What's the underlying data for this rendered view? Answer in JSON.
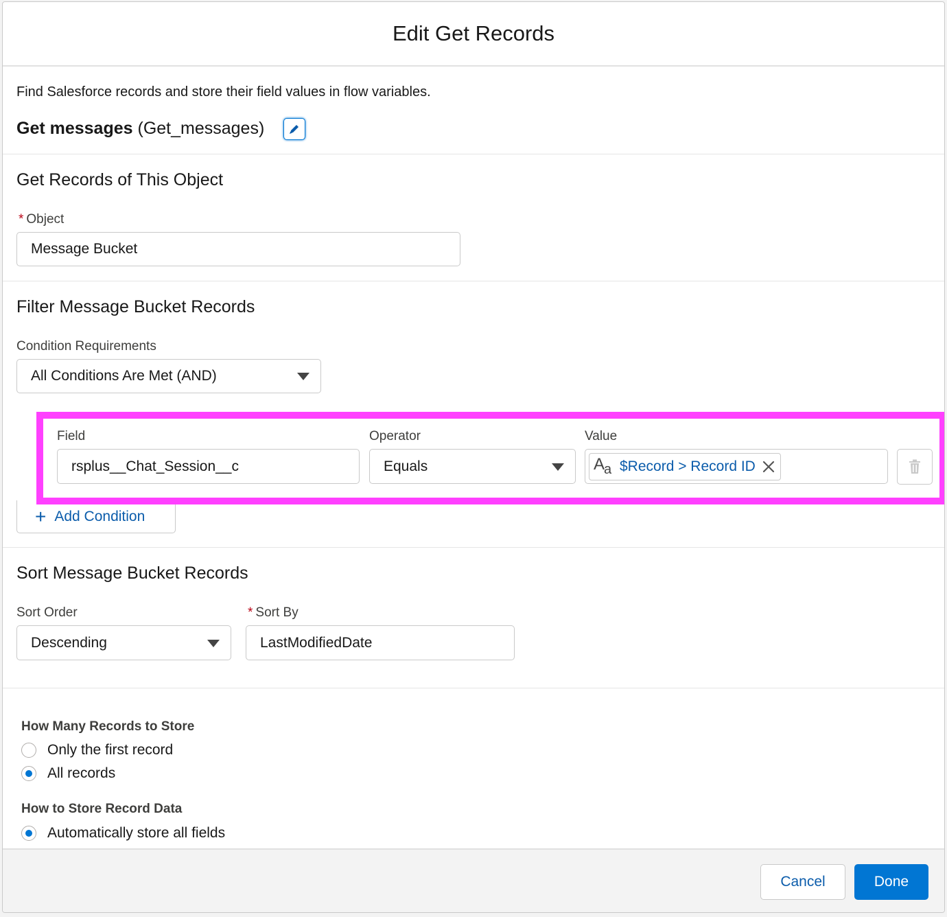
{
  "header": {
    "title": "Edit Get Records"
  },
  "intro": {
    "description": "Find Salesforce records and store their field values in flow variables.",
    "element_label": "Get messages",
    "element_api_name": "(Get_messages)"
  },
  "object_section": {
    "title": "Get Records of This Object",
    "object_label": "Object",
    "object_value": "Message Bucket"
  },
  "filter_section": {
    "title": "Filter Message Bucket Records",
    "condition_requirements_label": "Condition Requirements",
    "condition_requirements_value": "All Conditions Are Met (AND)",
    "condition": {
      "field_label": "Field",
      "field_value": "rsplus__Chat_Session__c",
      "operator_label": "Operator",
      "operator_value": "Equals",
      "value_label": "Value",
      "value_pill": "$Record > Record ID",
      "value_type_icon": "text-type-icon"
    },
    "add_condition_label": "Add Condition"
  },
  "sort_section": {
    "title": "Sort Message Bucket Records",
    "sort_order_label": "Sort Order",
    "sort_order_value": "Descending",
    "sort_by_label": "Sort By",
    "sort_by_value": "LastModifiedDate"
  },
  "store_section": {
    "how_many_label": "How Many Records to Store",
    "how_many_options": [
      {
        "label": "Only the first record",
        "checked": false
      },
      {
        "label": "All records",
        "checked": true
      }
    ],
    "how_to_store_label": "How to Store Record Data",
    "how_to_store_options": [
      {
        "label": "Automatically store all fields",
        "checked": true
      }
    ]
  },
  "footer": {
    "cancel_label": "Cancel",
    "done_label": "Done"
  },
  "colors": {
    "brand_blue": "#0176d3",
    "link_blue": "#0b5cab",
    "highlight_magenta": "#ff40ff",
    "required_red": "#ba0517"
  }
}
